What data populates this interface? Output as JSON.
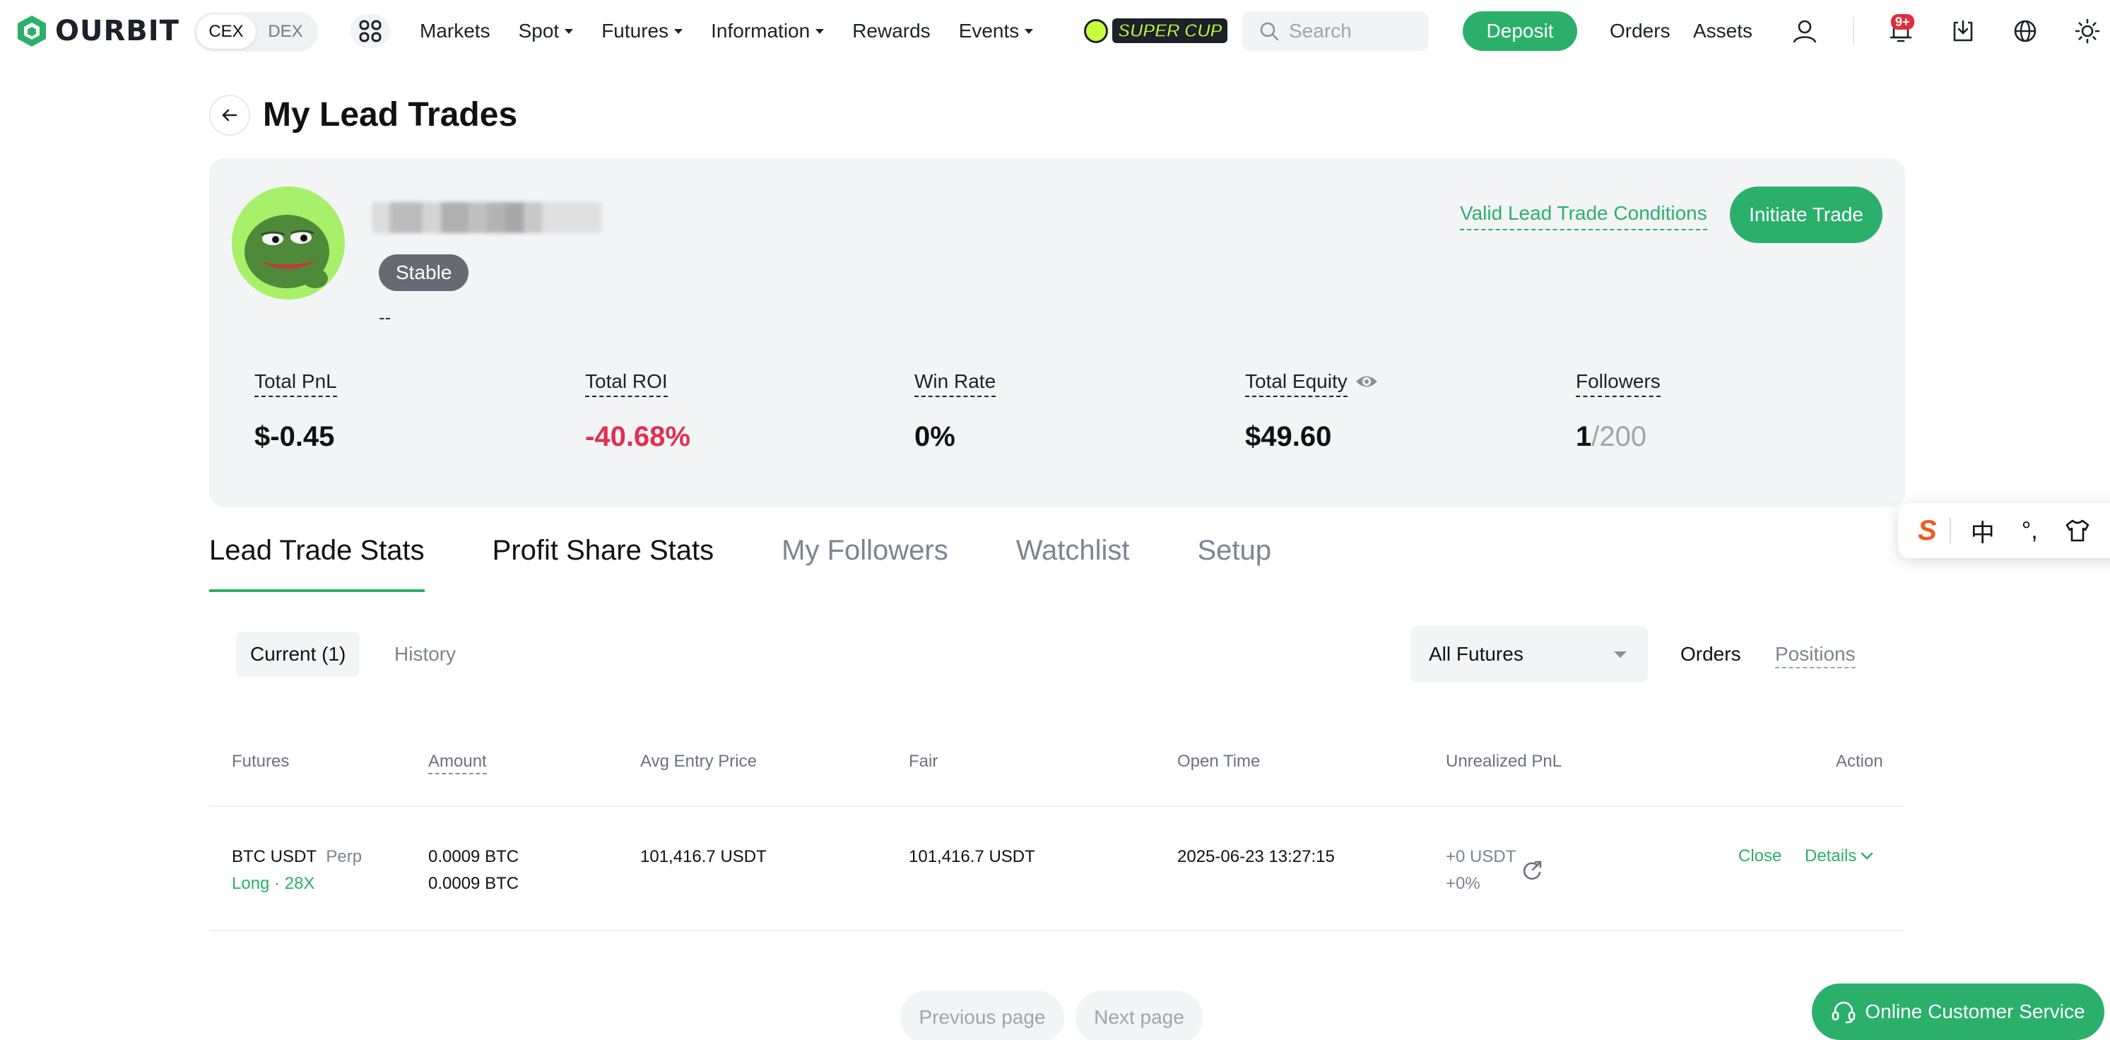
{
  "header": {
    "brand": "OURBIT",
    "mode_toggle": {
      "cex": "CEX",
      "dex": "DEX",
      "selected": "CEX"
    },
    "nav": [
      {
        "label": "Markets",
        "dropdown": false
      },
      {
        "label": "Spot",
        "dropdown": true
      },
      {
        "label": "Futures",
        "dropdown": true
      },
      {
        "label": "Information",
        "dropdown": true
      },
      {
        "label": "Rewards",
        "dropdown": false
      },
      {
        "label": "Events",
        "dropdown": true
      }
    ],
    "promo_label": "SUPER CUP",
    "search_placeholder": "Search",
    "deposit_label": "Deposit",
    "orders_label": "Orders",
    "assets_label": "Assets",
    "notification_badge": "9+",
    "icons": [
      "apps-icon",
      "search-icon",
      "user-icon",
      "bell-icon",
      "download-icon",
      "globe-icon",
      "sun-icon"
    ]
  },
  "page": {
    "title": "My Lead Trades"
  },
  "profile": {
    "tag": "Stable",
    "bio": "--",
    "valid_conditions_label": "Valid Lead Trade Conditions",
    "initiate_label": "Initiate Trade",
    "stats": {
      "total_pnl": {
        "label": "Total PnL",
        "value": "$-0.45"
      },
      "total_roi": {
        "label": "Total ROI",
        "value": "-40.68%"
      },
      "win_rate": {
        "label": "Win Rate",
        "value": "0%"
      },
      "total_equity": {
        "label": "Total Equity",
        "value": "$49.60"
      },
      "followers": {
        "label": "Followers",
        "value": "1",
        "max": "/200"
      }
    }
  },
  "ime_widget": {
    "logo": "S",
    "lang": "中",
    "punct": "°,"
  },
  "tabs": [
    {
      "label": "Lead Trade Stats",
      "active": true
    },
    {
      "label": "Profit Share Stats",
      "active": false
    },
    {
      "label": "My Followers",
      "active": false
    },
    {
      "label": "Watchlist",
      "active": false
    },
    {
      "label": "Setup",
      "active": false
    }
  ],
  "filters": {
    "current_label": "Current (1)",
    "history_label": "History",
    "futures_select": "All Futures",
    "orders_label": "Orders",
    "positions_label": "Positions"
  },
  "table": {
    "headers": {
      "futures": "Futures",
      "amount": "Amount",
      "avg_entry": "Avg Entry Price",
      "fair": "Fair",
      "open_time": "Open Time",
      "unrealized": "Unrealized PnL",
      "action": "Action"
    },
    "rows": [
      {
        "symbol": "BTC USDT",
        "contract": "Perp",
        "side": "Long · 28X",
        "amount_1": "0.0009 BTC",
        "amount_2": "0.0009 BTC",
        "avg_entry": "101,416.7 USDT",
        "fair": "101,416.7 USDT",
        "open_time": "2025-06-23 13:27:15",
        "pnl": "+0 USDT",
        "pnl_pct": "+0%",
        "close_label": "Close",
        "details_label": "Details"
      }
    ]
  },
  "pagination": {
    "prev_label": "Previous page",
    "next_label": "Next page"
  },
  "support_label": "Online Customer Service",
  "colors": {
    "accent_green": "#2bb06b",
    "negative_red": "#e0304f",
    "card_bg": "#f3f4f6"
  }
}
